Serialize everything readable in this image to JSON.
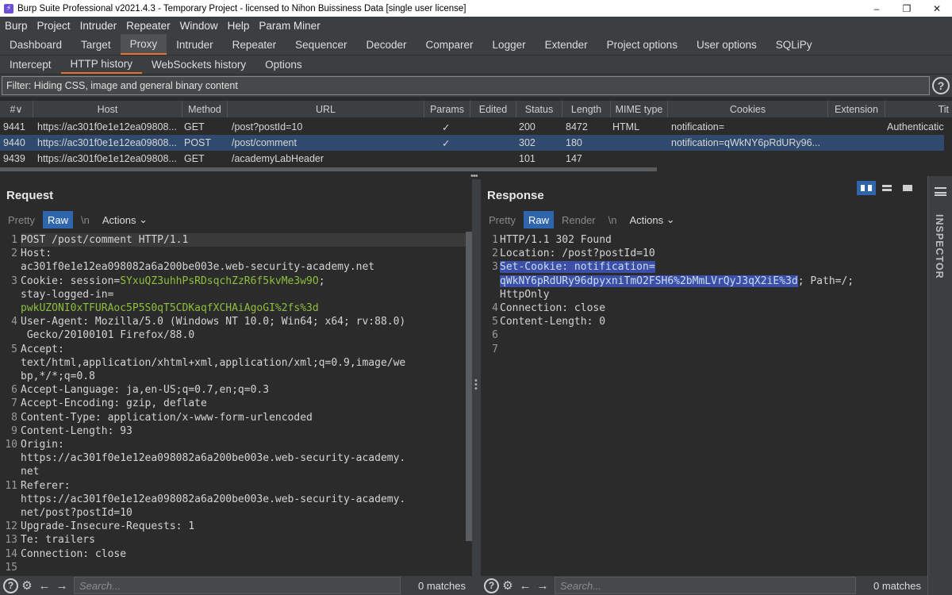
{
  "window": {
    "title": "Burp Suite Professional v2021.4.3 - Temporary Project - licensed to Nihon Buissiness Data [single user license]",
    "controls": [
      "–",
      "❐",
      "✕"
    ]
  },
  "menu": [
    "Burp",
    "Project",
    "Intruder",
    "Repeater",
    "Window",
    "Help",
    "Param Miner"
  ],
  "main_tabs": [
    "Dashboard",
    "Target",
    "Proxy",
    "Intruder",
    "Repeater",
    "Sequencer",
    "Decoder",
    "Comparer",
    "Logger",
    "Extender",
    "Project options",
    "User options",
    "SQLiPy"
  ],
  "main_tab_active": "Proxy",
  "sub_tabs": [
    "Intercept",
    "HTTP history",
    "WebSockets history",
    "Options"
  ],
  "sub_tab_active": "HTTP history",
  "filter": {
    "text": "Filter: Hiding CSS, image and general binary content",
    "help": "?"
  },
  "history": {
    "columns": [
      "# ",
      "Host",
      "Method",
      "URL",
      "Params",
      "Edited",
      "Status",
      "Length",
      "MIME type",
      "Cookies",
      "Extension",
      "Tit"
    ],
    "sort_indicator": "∨",
    "rows": [
      {
        "num": "9441",
        "host": "https://ac301f0e1e12ea09808...",
        "method": "GET",
        "url": "/post?postId=10",
        "params": "✓",
        "status": "200",
        "length": "8472",
        "mime": "HTML",
        "cookies": "notification=",
        "title": "Authenticatic"
      },
      {
        "num": "9440",
        "host": "https://ac301f0e1e12ea09808...",
        "method": "POST",
        "url": "/post/comment",
        "params": "✓",
        "status": "302",
        "length": "180",
        "mime": "",
        "cookies": "notification=qWkNY6pRdURy96...",
        "title": ""
      },
      {
        "num": "9439",
        "host": "https://ac301f0e1e12ea09808...",
        "method": "GET",
        "url": "/academyLabHeader",
        "params": "",
        "status": "101",
        "length": "147",
        "mime": "",
        "cookies": "",
        "title": ""
      }
    ]
  },
  "request": {
    "title": "Request",
    "tabs": [
      "Pretty",
      "Raw",
      "\\n"
    ],
    "actions": "Actions",
    "line_numbers": [
      "1",
      "2",
      "",
      "3",
      "",
      "",
      "4",
      "",
      "5",
      "",
      "",
      "6",
      "7",
      "8",
      "9",
      "10",
      "",
      "",
      "11",
      "",
      "",
      "12",
      "13",
      "14",
      "15"
    ],
    "lines": {
      "l1": "POST /post/comment HTTP/1.1",
      "l2a": "Host:",
      "l2b": "ac301f0e1e12ea098082a6a200be003e.web-security-academy.net",
      "l3a_key": "Cookie: session=",
      "l3a_val": "SYxuQZ3uhhPsRDsqchZzR6f5kvMe3w9O",
      "l3a_end": ";",
      "l3b": "stay-logged-in=",
      "l3c": "pwkUZONI0xTFURAoc5P5S0qT5CDKaqfXCHAiAgoGI%2fs%3d",
      "l4a": "User-Agent: Mozilla/5.0 (Windows NT 10.0; Win64; x64; rv:88.0)",
      "l4b": " Gecko/20100101 Firefox/88.0",
      "l5a": "Accept:",
      "l5b": "text/html,application/xhtml+xml,application/xml;q=0.9,image/we",
      "l5c": "bp,*/*;q=0.8",
      "l6": "Accept-Language: ja,en-US;q=0.7,en;q=0.3",
      "l7": "Accept-Encoding: gzip, deflate",
      "l8": "Content-Type: application/x-www-form-urlencoded",
      "l9": "Content-Length: 93",
      "l10a": "Origin:",
      "l10b": "https://ac301f0e1e12ea098082a6a200be003e.web-security-academy.",
      "l10c": "net",
      "l11a": "Referer:",
      "l11b": "https://ac301f0e1e12ea098082a6a200be003e.web-security-academy.",
      "l11c": "net/post?postId=10",
      "l12": "Upgrade-Insecure-Requests: 1",
      "l13": "Te: trailers",
      "l14": "Connection: close",
      "l15": ""
    },
    "search_placeholder": "Search...",
    "matches": "0 matches"
  },
  "response": {
    "title": "Response",
    "tabs": [
      "Pretty",
      "Raw",
      "Render",
      "\\n"
    ],
    "actions": "Actions",
    "line_numbers": [
      "1",
      "2",
      "3",
      "",
      "",
      "4",
      "5",
      "6",
      "7"
    ],
    "lines": {
      "l1": "HTTP/1.1 302 Found",
      "l2": "Location: /post?postId=10",
      "l3a": "Set-Cookie: notification=",
      "l3b": "qWkNY6pRdURy96dpyxniTmO2FSH6%2bMmLVrQyJ3qX2iE%3d",
      "l3b_end": "; Path=/;",
      "l3c": "HttpOnly",
      "l4": "Connection: close",
      "l5": "Content-Length: 0",
      "l6": "",
      "l7": ""
    },
    "search_placeholder": "Search...",
    "matches": "0 matches"
  },
  "inspector": {
    "label": "INSPECTOR"
  },
  "colors": {
    "accent": "#e8742a",
    "selected_row": "#2f4a6e",
    "active_tab_blue": "#2f65ad",
    "value_green": "#8fbf3f",
    "selection": "#3b4fa8"
  }
}
